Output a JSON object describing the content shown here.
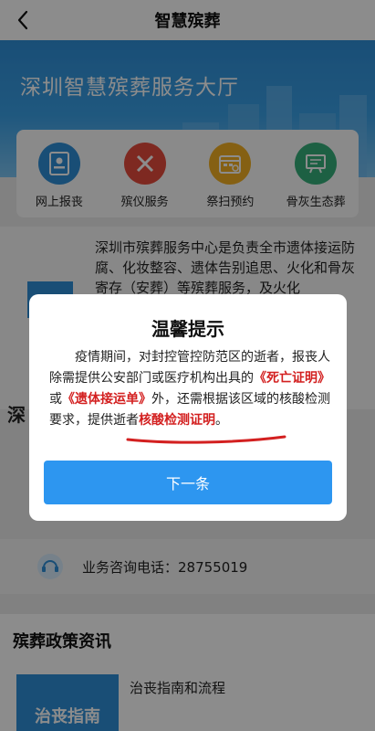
{
  "nav": {
    "title": "智慧殡葬"
  },
  "banner": {
    "title": "深圳智慧殡葬服务大厅"
  },
  "services": [
    {
      "label": "网上报丧",
      "icon": "document-person-icon",
      "color": "#2f8fd8"
    },
    {
      "label": "殡仪服务",
      "icon": "tools-icon",
      "color": "#e64b3c"
    },
    {
      "label": "祭扫预约",
      "icon": "calendar-icon",
      "color": "#f2b023"
    },
    {
      "label": "骨灰生态葬",
      "icon": "board-icon",
      "color": "#35b07a"
    }
  ],
  "intro": {
    "text": "深圳市殡葬服务中心是负责全市遗体接运防腐、化妆整容、遗体告别追思、火化和骨灰寄存（安葬）等殡葬服务，及火化"
  },
  "section_left_char": "深",
  "consult": {
    "text": "业务咨询电话：28755019"
  },
  "policy": {
    "heading": "殡葬政策资讯",
    "card_label": "治丧指南",
    "item": "治丧指南和流程"
  },
  "modal": {
    "title": "温馨提示",
    "p1": "疫情期间，对封控管控防范区的逝者，报丧人除需提供公安部门或医疗机构出具的",
    "doc1": "《死亡证明》",
    "p2": "或",
    "doc2": "《遗体接运单》",
    "p3": "外，还需根据该区域的核酸检测要求，提供逝者",
    "doc3": "核酸检测证明",
    "p4": "。",
    "button": "下一条"
  }
}
